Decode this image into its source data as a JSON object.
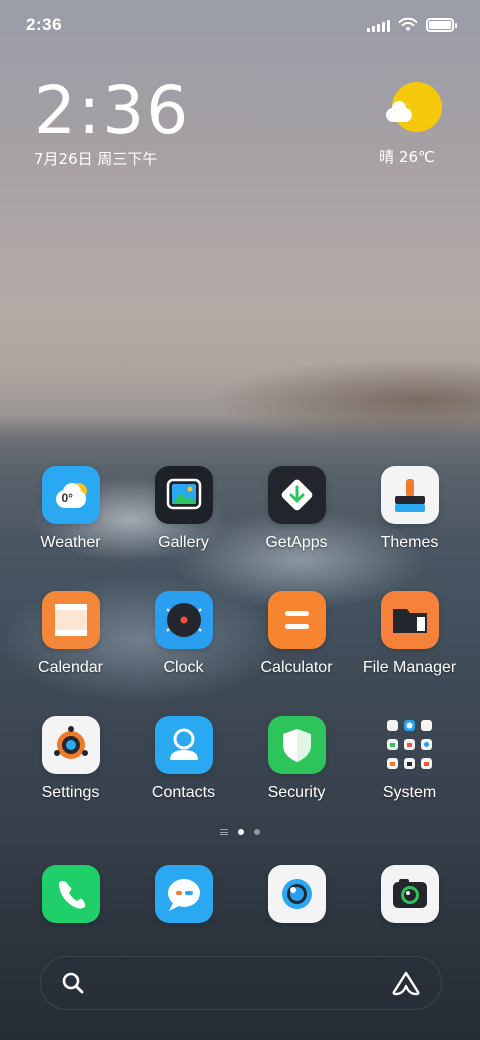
{
  "status_bar": {
    "time": "2:36",
    "battery_level": 1.0,
    "icons": [
      "signal-icon",
      "wifi-icon",
      "battery-icon"
    ]
  },
  "clock_widget": {
    "time": "2:36",
    "date": "7月26日 周三下午"
  },
  "weather_widget": {
    "condition_icon": "sunny-cloud-icon",
    "text": "晴 26℃"
  },
  "apps": [
    {
      "label": "Weather",
      "icon": "weather-icon",
      "badge_text": "0°",
      "color": "#2aa8f2"
    },
    {
      "label": "Gallery",
      "icon": "gallery-icon",
      "color": "#1e2128"
    },
    {
      "label": "GetApps",
      "icon": "getapps-icon",
      "color": "#22252c"
    },
    {
      "label": "Themes",
      "icon": "themes-icon",
      "color": "#f4f4f4"
    },
    {
      "label": "Calendar",
      "icon": "calendar-icon",
      "color": "#f5873a"
    },
    {
      "label": "Clock",
      "icon": "clock-icon",
      "color": "#2a9ff0"
    },
    {
      "label": "Calculator",
      "icon": "calculator-icon",
      "color": "#f7842e"
    },
    {
      "label": "File Manager",
      "icon": "file-manager-icon",
      "color": "#f5813a"
    },
    {
      "label": "Settings",
      "icon": "settings-icon",
      "color": "#f4f4f4"
    },
    {
      "label": "Contacts",
      "icon": "contacts-icon",
      "color": "#2aa8f2"
    },
    {
      "label": "Security",
      "icon": "security-icon",
      "color": "#2ec45c"
    },
    {
      "label": "System",
      "icon": "system-folder-icon",
      "color": "transparent"
    }
  ],
  "page_indicator": {
    "pages": 2,
    "current": 1
  },
  "dock": [
    {
      "icon": "phone-icon",
      "color": "#1fcf6a"
    },
    {
      "icon": "messages-icon",
      "color": "#2aa8f2"
    },
    {
      "icon": "browser-icon",
      "color": "#f4f4f4"
    },
    {
      "icon": "camera-icon",
      "color": "#f4f4f4"
    }
  ],
  "search_bar": {
    "left_icon": "search-icon",
    "right_icon": "assistant-icon"
  }
}
